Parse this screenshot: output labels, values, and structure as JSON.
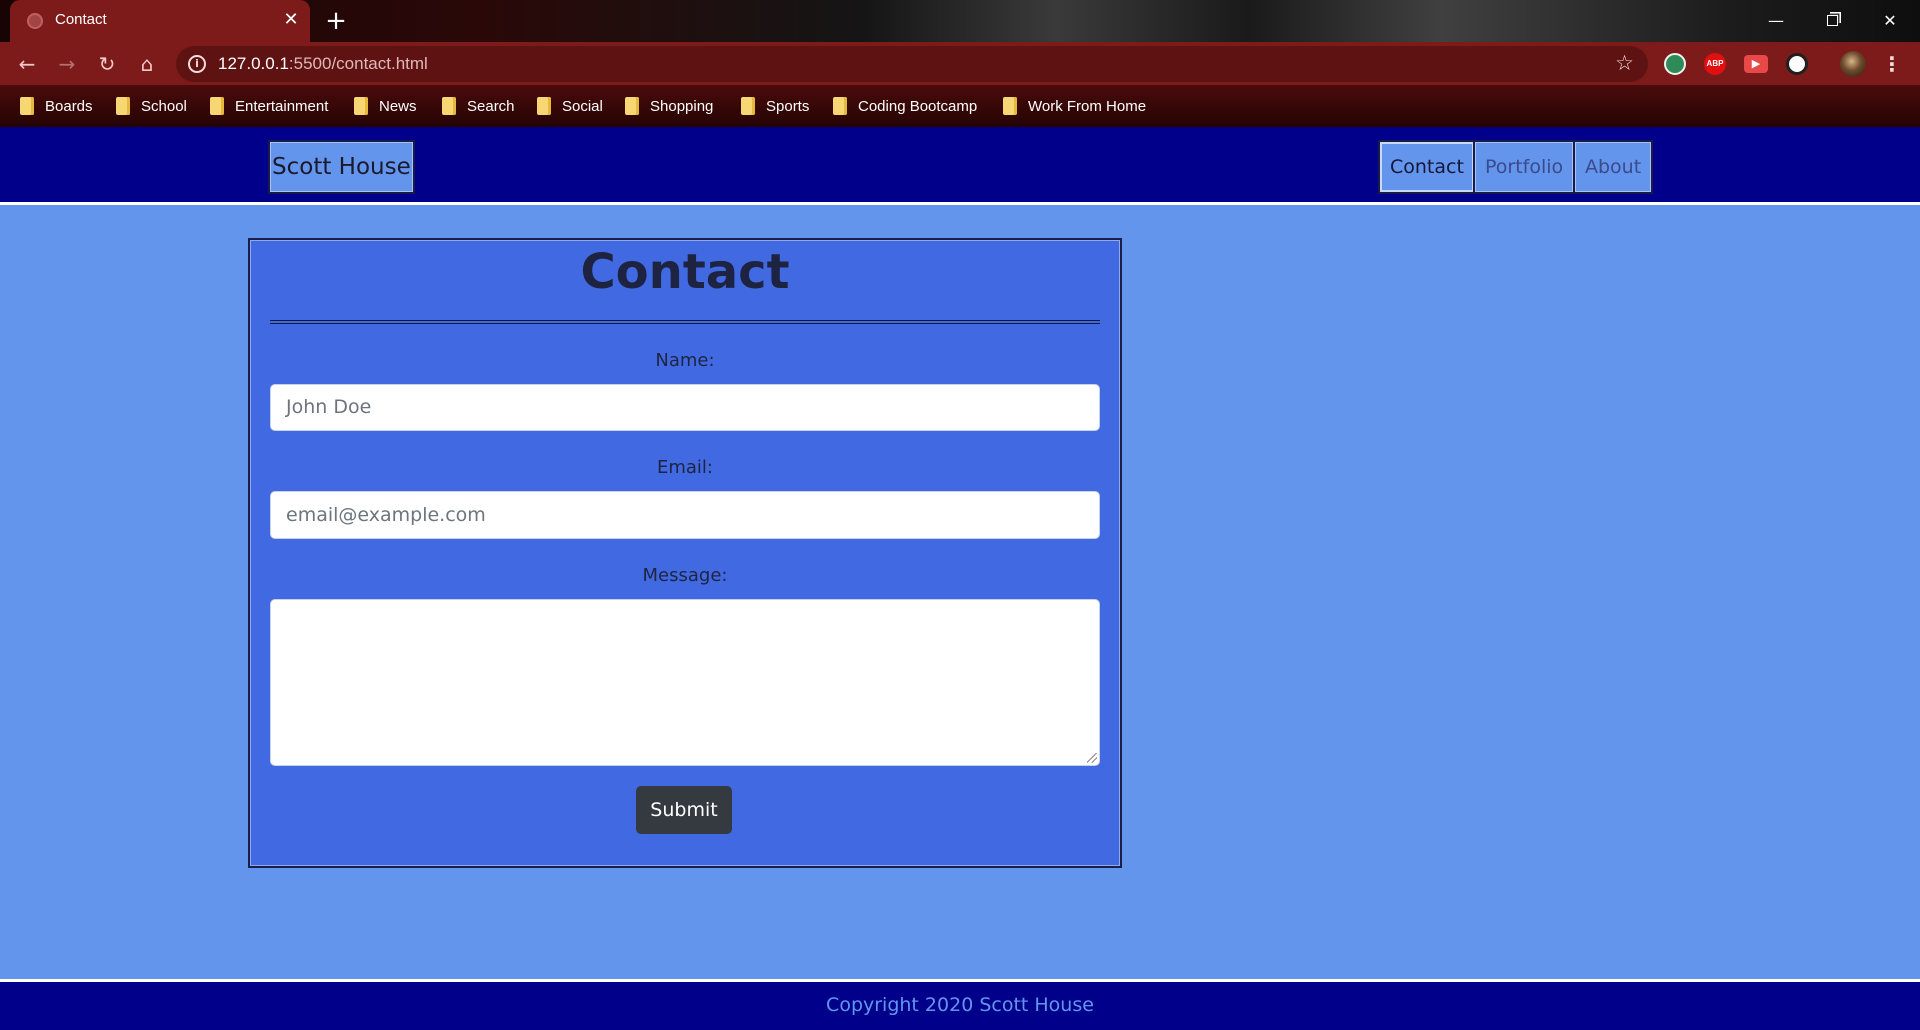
{
  "browser": {
    "tab": {
      "title": "Contact",
      "close": "✕"
    },
    "new_tab": "+",
    "window": {
      "minimize": "—",
      "close": "✕"
    },
    "nav": {
      "back": "←",
      "forward": "→",
      "reload": "↻",
      "home": "⌂"
    },
    "omnibox": {
      "info": "i",
      "url_host": "127.0.0.1",
      "url_rest": ":5500/contact.html",
      "star": "☆"
    },
    "extensions": {
      "abp": "ABP",
      "video": "▶"
    },
    "menu": "⋮",
    "bookmarks": [
      {
        "label": "Boards"
      },
      {
        "label": "School"
      },
      {
        "label": "Entertainment"
      },
      {
        "label": "News"
      },
      {
        "label": "Search"
      },
      {
        "label": "Social"
      },
      {
        "label": "Shopping"
      },
      {
        "label": "Sports"
      },
      {
        "label": "Coding Bootcamp"
      },
      {
        "label": "Work From Home"
      }
    ]
  },
  "site": {
    "brand": "Scott House",
    "nav": {
      "contact": "Contact",
      "portfolio": "Portfolio",
      "about": "About"
    },
    "contact_form": {
      "title": "Contact",
      "name_label": "Name:",
      "name_placeholder": "John Doe",
      "email_label": "Email:",
      "email_placeholder": "email@example.com",
      "message_label": "Message:",
      "message_value": "",
      "submit_label": "Submit"
    },
    "footer": "Copyright 2020 Scott House"
  },
  "colors": {
    "page_background": "#6495ED",
    "navbar_background": "#00008B",
    "card_background": "#4169E1",
    "submit_button": "#343a40"
  }
}
